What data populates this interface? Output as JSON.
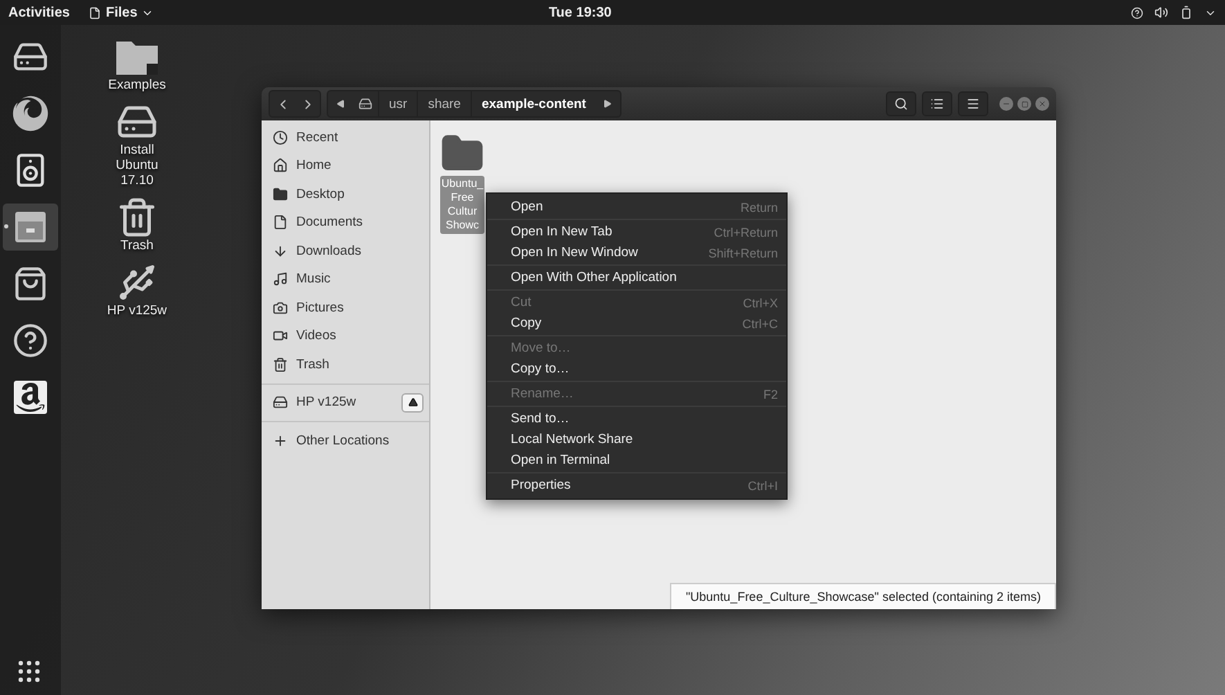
{
  "top_bar": {
    "activities": "Activities",
    "app_menu": "Files",
    "clock": "Tue 19:30"
  },
  "dock": {
    "items": [
      {
        "kind": "updater",
        "selected": false
      },
      {
        "kind": "browser",
        "selected": false
      },
      {
        "kind": "speaker",
        "selected": false
      },
      {
        "kind": "files",
        "selected": true
      },
      {
        "kind": "store",
        "selected": false
      },
      {
        "kind": "help",
        "selected": false
      },
      {
        "kind": "amazon",
        "selected": false
      }
    ]
  },
  "desktop_icons": [
    {
      "kind": "folder-link",
      "label": "Examples"
    },
    {
      "kind": "installer",
      "label": "Install Ubuntu 17.10"
    },
    {
      "kind": "trash",
      "label": "Trash"
    },
    {
      "kind": "usb",
      "label": "HP v125w"
    }
  ],
  "window": {
    "path": [
      {
        "label": "usr",
        "selected": false
      },
      {
        "label": "share",
        "selected": false
      },
      {
        "label": "example-content",
        "selected": true
      }
    ],
    "sidebar": {
      "places": [
        {
          "kind": "recent",
          "label": "Recent"
        },
        {
          "kind": "home",
          "label": "Home"
        },
        {
          "kind": "desktop",
          "label": "Desktop"
        },
        {
          "kind": "documents",
          "label": "Documents"
        },
        {
          "kind": "downloads",
          "label": "Downloads"
        },
        {
          "kind": "music",
          "label": "Music"
        },
        {
          "kind": "pictures",
          "label": "Pictures"
        },
        {
          "kind": "videos",
          "label": "Videos"
        },
        {
          "kind": "trash",
          "label": "Trash"
        }
      ],
      "devices": [
        {
          "label": "HP v125w"
        }
      ],
      "other": "Other Locations"
    },
    "files": [
      {
        "label_lines": [
          "Ubuntu_",
          "Free",
          "Cultur",
          "Showc"
        ],
        "selected": true
      }
    ],
    "status": "\"Ubuntu_Free_Culture_Showcase\" selected  (containing 2 items)"
  },
  "context_menu": {
    "sections": [
      [
        {
          "label": "Open",
          "shortcut": "Return",
          "disabled": false
        }
      ],
      [
        {
          "label": "Open In New Tab",
          "shortcut": "Ctrl+Return",
          "disabled": false
        },
        {
          "label": "Open In New Window",
          "shortcut": "Shift+Return",
          "disabled": false
        }
      ],
      [
        {
          "label": "Open With Other Application",
          "disabled": false
        }
      ],
      [
        {
          "label": "Cut",
          "shortcut": "Ctrl+X",
          "disabled": true
        },
        {
          "label": "Copy",
          "shortcut": "Ctrl+C",
          "disabled": false
        }
      ],
      [
        {
          "label": "Move to…",
          "disabled": true
        },
        {
          "label": "Copy to…",
          "disabled": false
        }
      ],
      [
        {
          "label": "Rename…",
          "shortcut": "F2",
          "disabled": true
        }
      ],
      [
        {
          "label": "Send to…",
          "disabled": false
        },
        {
          "label": "Local Network Share",
          "disabled": false
        },
        {
          "label": "Open in Terminal",
          "disabled": false
        }
      ],
      [
        {
          "label": "Properties",
          "shortcut": "Ctrl+I",
          "disabled": false
        }
      ]
    ]
  }
}
